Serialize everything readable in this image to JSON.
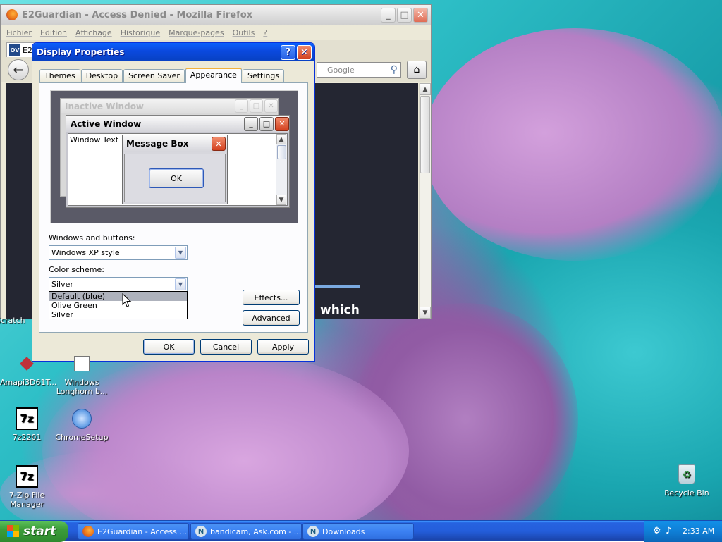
{
  "firefox": {
    "title": "E2Guardian - Access Denied - Mozilla Firefox",
    "menu": [
      "Fichier",
      "Edition",
      "Affichage",
      "Historique",
      "Marque-pages",
      "Outils",
      "?"
    ],
    "tab_label": "E2",
    "search_placeholder": "Google",
    "content_word": "which"
  },
  "dialog": {
    "title": "Display Properties",
    "tabs": [
      "Themes",
      "Desktop",
      "Screen Saver",
      "Appearance",
      "Settings"
    ],
    "active_tab": "Appearance",
    "preview": {
      "inactive_title": "Inactive Window",
      "active_title": "Active Window",
      "window_text": "Window Text",
      "message_title": "Message Box",
      "ok": "OK"
    },
    "windows_buttons_label": "Windows and buttons:",
    "windows_buttons_value": "Windows XP style",
    "color_scheme_label": "Color scheme:",
    "color_scheme_value": "Silver",
    "color_scheme_options": [
      "Default (blue)",
      "Olive Green",
      "Silver"
    ],
    "color_scheme_highlighted": "Default (blue)",
    "effects_button": "Effects...",
    "advanced_button": "Advanced",
    "ok_button": "OK",
    "cancel_button": "Cancel",
    "apply_button": "Apply"
  },
  "desktop_icons": {
    "partial_label": "Scratch",
    "amapi": "Amapi3D61T...",
    "longhorn": "Windows Longhorn b...",
    "sevenz": "7z2201",
    "sevenz_badge": "7z",
    "chrome": "ChromeSetup",
    "sevenzip_manager": "7-Zip File Manager",
    "recycle": "Recycle Bin"
  },
  "taskbar": {
    "start": "start",
    "buttons": [
      "E2Guardian - Access ...",
      "bandicam, Ask.com - ...",
      "Downloads"
    ],
    "clock": "2:33 AM"
  }
}
